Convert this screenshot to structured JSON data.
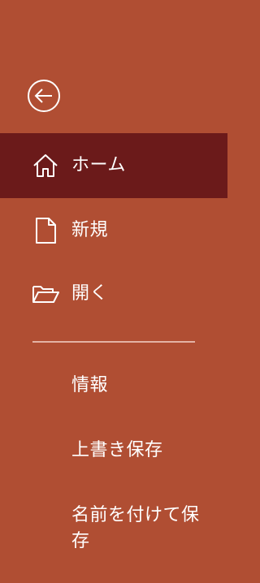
{
  "colors": {
    "background": "#b04e33",
    "selected_background": "#6b1a1a",
    "divider": "#e3b3a5",
    "text": "#ffffff"
  },
  "back": {
    "icon": "back-arrow-icon"
  },
  "nav": {
    "items": [
      {
        "label": "ホーム",
        "icon": "home-icon",
        "selected": true
      },
      {
        "label": "新規",
        "icon": "new-document-icon",
        "selected": false
      },
      {
        "label": "開く",
        "icon": "open-folder-icon",
        "selected": false
      }
    ]
  },
  "menu": {
    "items": [
      {
        "label": "情報"
      },
      {
        "label": "上書き保存"
      },
      {
        "label": "名前を付けて保存"
      }
    ]
  }
}
